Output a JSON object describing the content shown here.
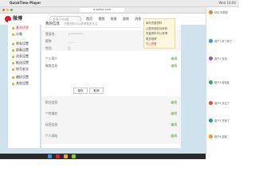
{
  "menubar": {
    "app": "QuickTime Player",
    "clock": "Wed 10:00"
  },
  "browser": {
    "url": "d.weibo.com"
  },
  "header": {
    "logo_text": "微博",
    "search_placeholder": "大家正在搜",
    "nav": [
      "首页",
      "视频",
      "发现",
      "游戏",
      "消息"
    ]
  },
  "sidebar": {
    "items": [
      {
        "label": "基本信息",
        "active": true
      },
      {
        "label": "头像",
        "active": false
      },
      {
        "label": "隐私设置",
        "active": false
      },
      {
        "label": "屏蔽设置",
        "active": false
      },
      {
        "label": "消息设置",
        "active": false
      },
      {
        "label": "推送设置",
        "active": false
      },
      {
        "label": "账号安全",
        "active": false
      },
      {
        "label": "偏好设置",
        "active": false
      },
      {
        "label": "其他设置",
        "active": false
      }
    ]
  },
  "main": {
    "title": "我的信息",
    "note": "完善资料可以获得更多关注",
    "rows": [
      {
        "label": "登录名",
        "value": "1*********",
        "edit": ""
      },
      {
        "label": "昵称",
        "value": "_____",
        "edit": ""
      },
      {
        "label": "性别",
        "value": "女",
        "edit": ""
      },
      {
        "label": "个人简介",
        "value": "",
        "edit": "编辑"
      },
      {
        "label": "教育信息",
        "value": "",
        "edit": "编辑"
      },
      {
        "label": "职业信息",
        "value": "",
        "edit": "编辑"
      },
      {
        "label": "个性域名",
        "value": "",
        "edit": "编辑"
      },
      {
        "label": "标签信息",
        "value": "",
        "edit": "编辑"
      },
      {
        "label": "个人网站",
        "value": "",
        "edit": "编辑"
      }
    ],
    "save_label": "保存",
    "cancel_label": "取消"
  },
  "popup": {
    "lines": [
      "填写完整资料",
      "让更多朋友找到你",
      "完善资料可以获得",
      "更多推荐",
      "马上完善"
    ]
  },
  "chat": {
    "items": [
      {
        "name": "评论",
        "text": "好看的",
        "color": "#e67e22"
      },
      {
        "name": "用户1",
        "text": "来了来了",
        "color": "#3498db"
      },
      {
        "name": "用户2",
        "text": "支持",
        "color": "#9b59b6"
      },
      {
        "name": "用户3",
        "text": "哈哈哈",
        "color": "#27ae60"
      },
      {
        "name": "用户4",
        "text": "关注了",
        "color": "#e74c3c"
      },
      {
        "name": "用户5",
        "text": "学到了",
        "color": "#16a085"
      },
      {
        "name": "用户6",
        "text": "谢谢",
        "color": "#f39c12"
      }
    ]
  }
}
